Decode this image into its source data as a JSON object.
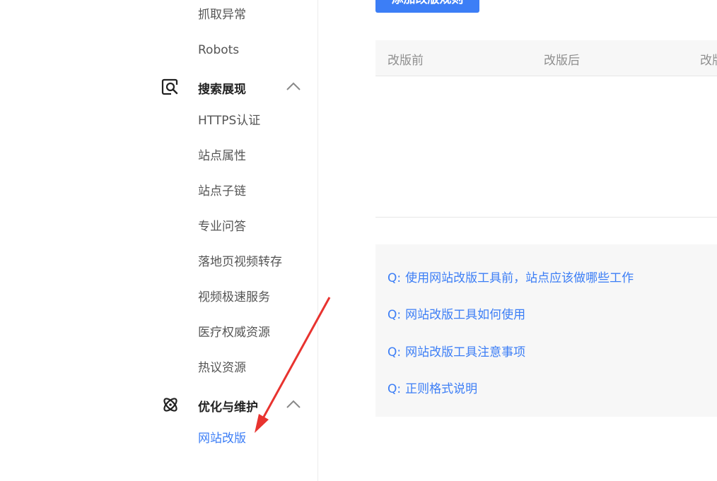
{
  "sidebar": {
    "items_top": [
      {
        "label": "抓取异常"
      },
      {
        "label": "Robots"
      }
    ],
    "sections": [
      {
        "label": "搜索展现",
        "icon": "search-display-icon",
        "items": [
          {
            "label": "HTTPS认证"
          },
          {
            "label": "站点属性"
          },
          {
            "label": "站点子链"
          },
          {
            "label": "专业问答"
          },
          {
            "label": "落地页视频转存"
          },
          {
            "label": "视频极速服务"
          },
          {
            "label": "医疗权威资源"
          },
          {
            "label": "热议资源"
          }
        ]
      },
      {
        "label": "优化与维护",
        "icon": "atom-icon",
        "items": [
          {
            "label": "网站改版",
            "active": true
          }
        ]
      }
    ]
  },
  "main": {
    "add_button_label": "添加改版规则",
    "table": {
      "columns": [
        "改版前",
        "改版后",
        "改版"
      ]
    },
    "faq": [
      {
        "q": "Q:",
        "text": "使用网站改版工具前，站点应该做哪些工作"
      },
      {
        "q": "Q:",
        "text": "网站改版工具如何使用"
      },
      {
        "q": "Q:",
        "text": "网站改版工具注意事项"
      },
      {
        "q": "Q:",
        "text": "正则格式说明"
      }
    ]
  },
  "colors": {
    "accent": "#3c7ef6",
    "annotation_arrow": "#e8332f",
    "panel_bg": "#f7f7f7"
  }
}
